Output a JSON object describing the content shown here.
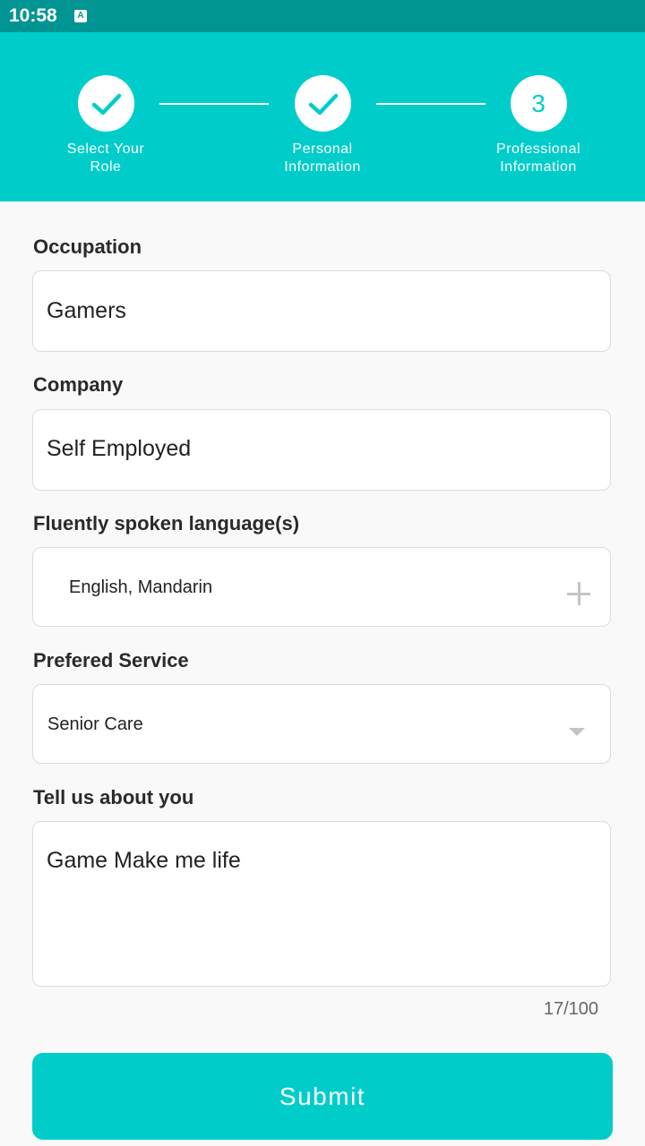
{
  "status_bar": {
    "time": "10:58",
    "notification_icon": "A"
  },
  "stepper": {
    "steps": [
      {
        "label_line1": "Select Your",
        "label_line2": "Role",
        "state": "done"
      },
      {
        "label_line1": "Personal",
        "label_line2": "Information",
        "state": "done"
      },
      {
        "label_line1": "Professional",
        "label_line2": "Information",
        "state": "current",
        "number": "3"
      }
    ]
  },
  "form": {
    "occupation": {
      "label": "Occupation",
      "value": "Gamers"
    },
    "company": {
      "label": "Company",
      "value": "Self Employed"
    },
    "languages": {
      "label": "Fluently spoken language(s)",
      "value": "English, Mandarin",
      "icon": "plus-icon"
    },
    "service": {
      "label": "Prefered Service",
      "value": "Senior Care",
      "icon": "chevron-down-icon"
    },
    "about": {
      "label": "Tell us about you",
      "value": "Game Make me life",
      "counter": "17/100"
    }
  },
  "submit_label": "Submit",
  "colors": {
    "accent": "#00cdca",
    "status_bar": "#009592"
  }
}
